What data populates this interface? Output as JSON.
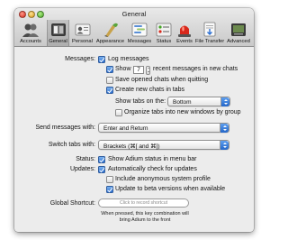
{
  "window": {
    "title": "General"
  },
  "toolbar": {
    "items": [
      {
        "label": "Accounts",
        "icon": "accounts-icon",
        "selected": false
      },
      {
        "label": "General",
        "icon": "general-switch-icon",
        "selected": true
      },
      {
        "label": "Personal",
        "icon": "personal-card-icon",
        "selected": false
      },
      {
        "label": "Appearance",
        "icon": "appearance-brush-icon",
        "selected": false
      },
      {
        "label": "Messages",
        "icon": "messages-icon",
        "selected": false
      },
      {
        "label": "Status",
        "icon": "status-icon",
        "selected": false
      },
      {
        "label": "Events",
        "icon": "events-siren-icon",
        "selected": false
      },
      {
        "label": "File Transfer",
        "icon": "file-transfer-icon",
        "selected": false
      },
      {
        "label": "Advanced",
        "icon": "advanced-icon",
        "selected": false
      }
    ]
  },
  "messages": {
    "label": "Messages:",
    "log_messages": {
      "label": "Log messages",
      "checked": true
    },
    "show": {
      "label": "Show",
      "checked": true,
      "count": "7",
      "suffix": "recent messages in new chats"
    },
    "save_chats": {
      "label": "Save opened chats when quitting",
      "checked": false
    },
    "create_tabs": {
      "label": "Create new chats in tabs",
      "checked": true
    },
    "tabs_on": {
      "label": "Show tabs on the:",
      "value": "Bottom"
    },
    "organize_tabs": {
      "label": "Organize tabs into new windows by group",
      "checked": false
    }
  },
  "send_messages": {
    "label": "Send messages with:",
    "value": "Enter and Return"
  },
  "switch_tabs": {
    "label": "Switch tabs with:",
    "value": "Brackets (⌘[ and ⌘])"
  },
  "status": {
    "label": "Status:",
    "show_status": {
      "label": "Show Adium status in menu bar",
      "checked": true
    }
  },
  "updates": {
    "label": "Updates:",
    "auto_check": {
      "label": "Automatically check for updates",
      "checked": true
    },
    "anon_profile": {
      "label": "Include anonymous system profile",
      "checked": false
    },
    "beta": {
      "label": "Update to beta versions when available",
      "checked": true
    }
  },
  "global_shortcut": {
    "label": "Global Shortcut:",
    "placeholder": "Click to record shortcut",
    "hint_line1": "When pressed, this key combination will",
    "hint_line2": "bring Adium to the front"
  },
  "colors": {
    "accent": "#2b6fd2",
    "window_bg": "#ececec",
    "toolbar_top": "#e9e9e9",
    "toolbar_bottom": "#c9c9c9"
  }
}
